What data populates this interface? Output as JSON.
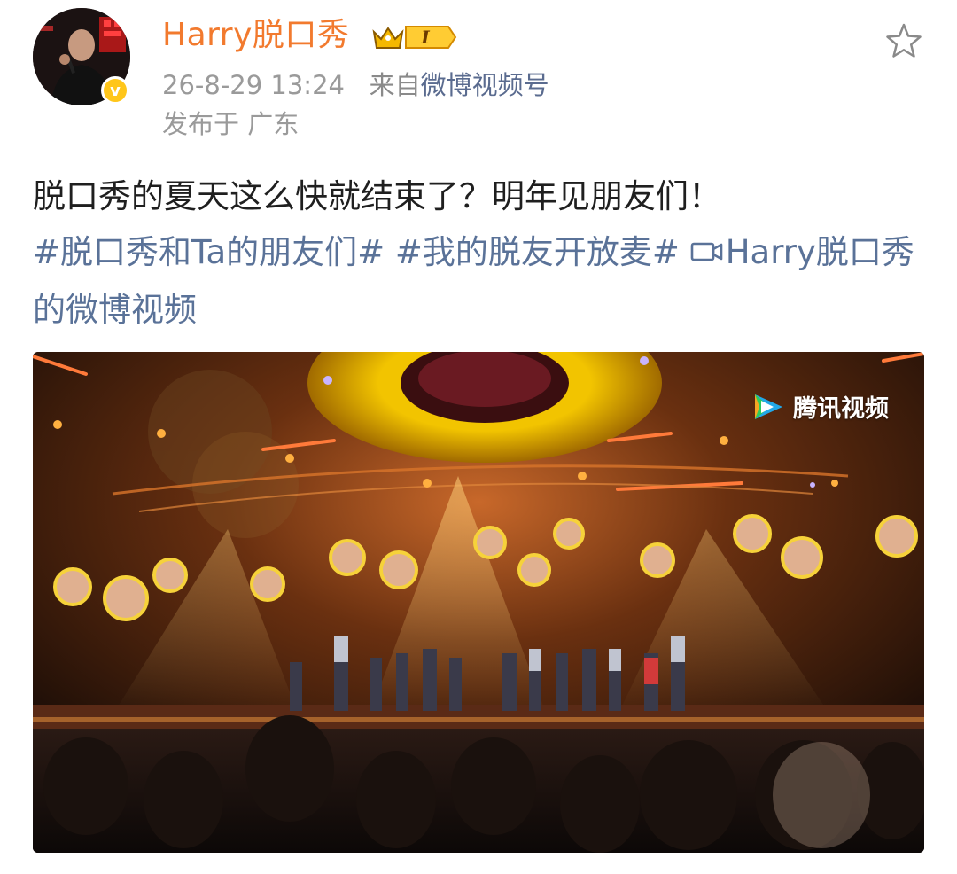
{
  "post": {
    "username": "Harry脱口秀",
    "member_badge": "I",
    "timestamp": "26-8-29 13:24",
    "source_prefix": "来自",
    "source_name": "微博视频号",
    "location": "发布于 广东",
    "body": {
      "text": "脱口秀的夏天这么快就结束了？明年见朋友们！",
      "tags": [
        "#脱口秀和Ta的朋友们#",
        "#我的脱友开放麦#"
      ],
      "video_link_label": "Harry脱口秀的微博视频"
    },
    "video": {
      "watermark": "腾讯视频"
    }
  },
  "colors": {
    "username": "#f27a2e",
    "link": "#5a7298",
    "meta": "#9a9a9a",
    "badge_gold": "#ffc61a"
  },
  "icons": {
    "star": "star-outline-icon",
    "verified": "verified-v-icon",
    "crown": "crown-icon",
    "camera": "video-camera-icon"
  }
}
